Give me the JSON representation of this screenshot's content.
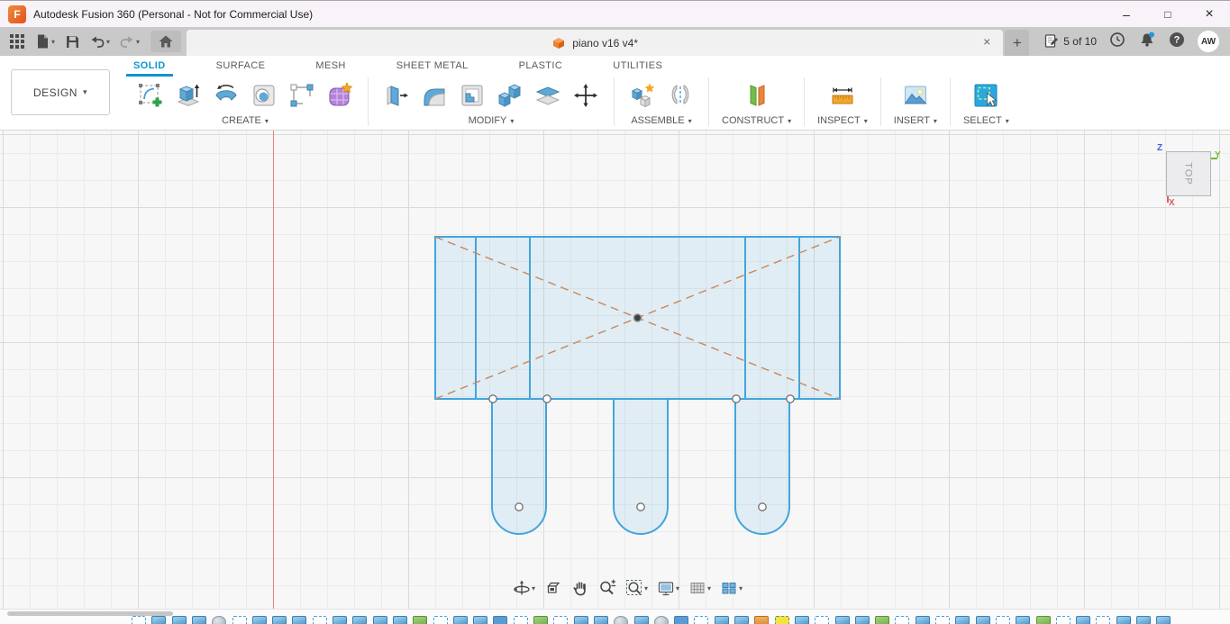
{
  "window": {
    "title": "Autodesk Fusion 360 (Personal - Not for Commercial Use)",
    "app_letter": "F",
    "controls": {
      "minimize": "–",
      "maximize": "□",
      "close": "×"
    }
  },
  "glyphs": {
    "caret": "▾",
    "close": "×",
    "plus": "+",
    "home": "⌂"
  },
  "tabbar": {
    "document_title": "piano v16 v4*",
    "job_status": "5 of 10",
    "help_glyph": "?",
    "avatar_initials": "AW"
  },
  "ribbon": {
    "design_label": "DESIGN",
    "tabs": [
      "SOLID",
      "SURFACE",
      "MESH",
      "SHEET METAL",
      "PLASTIC",
      "UTILITIES"
    ],
    "active_tab": "SOLID",
    "groups": [
      {
        "label": "CREATE",
        "tools": [
          "create-sketch",
          "extrude",
          "revolve",
          "hole",
          "rectangular-pattern",
          "form"
        ]
      },
      {
        "label": "MODIFY",
        "tools": [
          "press-pull",
          "fillet",
          "shell",
          "combine",
          "split-body",
          "move"
        ]
      },
      {
        "label": "ASSEMBLE",
        "tools": [
          "new-component",
          "joint"
        ]
      },
      {
        "label": "CONSTRUCT",
        "tools": [
          "construct-plane"
        ]
      },
      {
        "label": "INSPECT",
        "tools": [
          "measure"
        ]
      },
      {
        "label": "INSERT",
        "tools": [
          "insert-image"
        ]
      },
      {
        "label": "SELECT",
        "tools": [
          "select"
        ]
      }
    ]
  },
  "viewcube": {
    "face": "TOP",
    "axis_x": "X",
    "axis_y": "Y",
    "axis_z": "Z"
  },
  "navbar": {
    "tools": [
      {
        "name": "orbit",
        "caret": true
      },
      {
        "name": "look-at",
        "caret": false
      },
      {
        "name": "pan",
        "caret": false
      },
      {
        "name": "zoom",
        "caret": false
      },
      {
        "name": "fit",
        "caret": true
      },
      {
        "name": "display-settings",
        "caret": true
      },
      {
        "name": "grid-and-snaps",
        "caret": true
      },
      {
        "name": "viewports",
        "caret": true
      }
    ]
  },
  "timeline": {
    "features": [
      "sketch",
      "extrude",
      "extrude",
      "extrude",
      "revolve",
      "sketch",
      "extrude",
      "extrude",
      "extrude",
      "sketch",
      "extrude",
      "extrude",
      "extrude",
      "extrude",
      "form",
      "sketch",
      "extrude",
      "extrude",
      "extrude-flat",
      "sketch",
      "form",
      "sketch",
      "extrude",
      "extrude",
      "revolve",
      "extrude",
      "revolve",
      "extrude-flat",
      "sketch",
      "extrude",
      "extrude",
      "hole",
      "sketch-active",
      "extrude",
      "sketch",
      "extrude",
      "extrude",
      "form",
      "sketch",
      "extrude",
      "sketch",
      "extrude",
      "extrude",
      "sketch",
      "extrude",
      "form",
      "sketch",
      "extrude",
      "sketch",
      "extrude",
      "extrude",
      "extrude"
    ]
  },
  "colors": {
    "accent": "#0a96d2",
    "sketch_blue": "#42a5dc",
    "construction_tan": "#c9875c",
    "origin_red": "#e87d79",
    "highlight_yellow": "#f3e43b"
  }
}
